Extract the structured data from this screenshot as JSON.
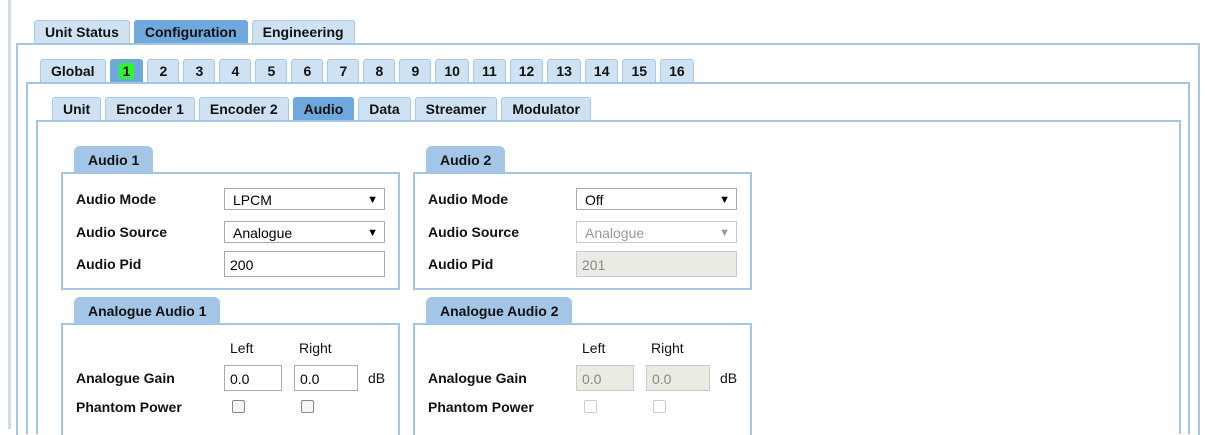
{
  "top_tabs": [
    "Unit Status",
    "Configuration",
    "Engineering"
  ],
  "unit_tabs": [
    "Global",
    "1",
    "2",
    "3",
    "4",
    "5",
    "6",
    "7",
    "8",
    "9",
    "10",
    "11",
    "12",
    "13",
    "14",
    "15",
    "16"
  ],
  "sub_tabs": [
    "Unit",
    "Encoder 1",
    "Encoder 2",
    "Audio",
    "Data",
    "Streamer",
    "Modulator"
  ],
  "audio1": {
    "title": "Audio 1",
    "mode_label": "Audio Mode",
    "mode_value": "LPCM",
    "source_label": "Audio Source",
    "source_value": "Analogue",
    "pid_label": "Audio Pid",
    "pid_value": "200"
  },
  "audio2": {
    "title": "Audio 2",
    "mode_label": "Audio Mode",
    "mode_value": "Off",
    "source_label": "Audio Source",
    "source_value": "Analogue",
    "pid_label": "Audio Pid",
    "pid_value": "201"
  },
  "analogue1": {
    "title": "Analogue Audio 1",
    "left_header": "Left",
    "right_header": "Right",
    "gain_label": "Analogue Gain",
    "gain_left": "0.0",
    "gain_right": "0.0",
    "unit": "dB",
    "phantom_label": "Phantom Power"
  },
  "analogue2": {
    "title": "Analogue Audio 2",
    "left_header": "Left",
    "right_header": "Right",
    "gain_label": "Analogue Gain",
    "gain_left": "0.0",
    "gain_right": "0.0",
    "unit": "dB",
    "phantom_label": "Phantom Power"
  },
  "colors": {
    "tab": "#cfe2f3",
    "active_tab": "#6fa8dc",
    "border": "#a3c6e6",
    "selected_unit": "#2ef52e"
  }
}
